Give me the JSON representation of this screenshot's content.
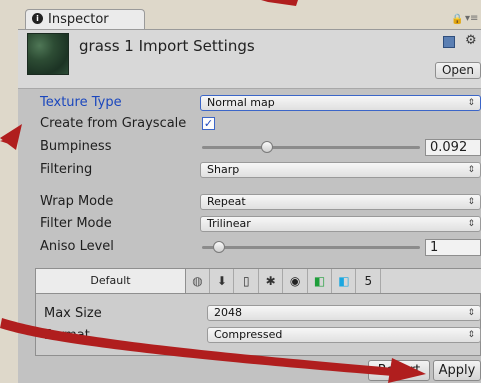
{
  "inspector": {
    "tab_label": "Inspector",
    "tab_icon": "i",
    "lock_icon": "🔒",
    "menu_icon": "▾≡"
  },
  "header": {
    "title": "grass 1 Import Settings",
    "open_label": "Open",
    "settings_icon": "⚙"
  },
  "properties": {
    "texture_type": {
      "label": "Texture Type",
      "value": "Normal map"
    },
    "create_from_grayscale": {
      "label": "Create from Grayscale",
      "checked": true,
      "check_glyph": "✓"
    },
    "bumpiness": {
      "label": "Bumpiness",
      "value": "0.092",
      "slider_fraction": 0.3
    },
    "filtering": {
      "label": "Filtering",
      "value": "Sharp"
    },
    "wrap_mode": {
      "label": "Wrap Mode",
      "value": "Repeat"
    },
    "filter_mode": {
      "label": "Filter Mode",
      "value": "Trilinear"
    },
    "aniso_level": {
      "label": "Aniso Level",
      "value": "1",
      "slider_fraction": 0.08
    }
  },
  "platforms": {
    "default_tab": "Default",
    "tabs": [
      {
        "name": "web-platform-icon",
        "glyph": "◍",
        "color": "#555555"
      },
      {
        "name": "standalone-platform-icon",
        "glyph": "⬇",
        "color": "#333333"
      },
      {
        "name": "ios-platform-icon",
        "glyph": "▯",
        "color": "#333333"
      },
      {
        "name": "android-platform-icon",
        "glyph": "✱",
        "color": "#333333"
      },
      {
        "name": "blackberry-platform-icon",
        "glyph": "◉",
        "color": "#222222"
      },
      {
        "name": "windows-store-platform-icon",
        "glyph": "◧",
        "color": "#1e9e3a"
      },
      {
        "name": "windows-phone-platform-icon",
        "glyph": "◧",
        "color": "#1aa7e0"
      },
      {
        "name": "html5-platform-icon",
        "glyph": "5",
        "color": "#222222"
      }
    ],
    "max_size": {
      "label": "Max Size",
      "value": "2048"
    },
    "format": {
      "label": "Format",
      "value": "Compressed"
    }
  },
  "buttons": {
    "revert_label": "Revert",
    "apply_label": "Apply"
  },
  "colors": {
    "annotation_arrow": "#b01e1e",
    "accent_blue": "#1b47bd"
  }
}
